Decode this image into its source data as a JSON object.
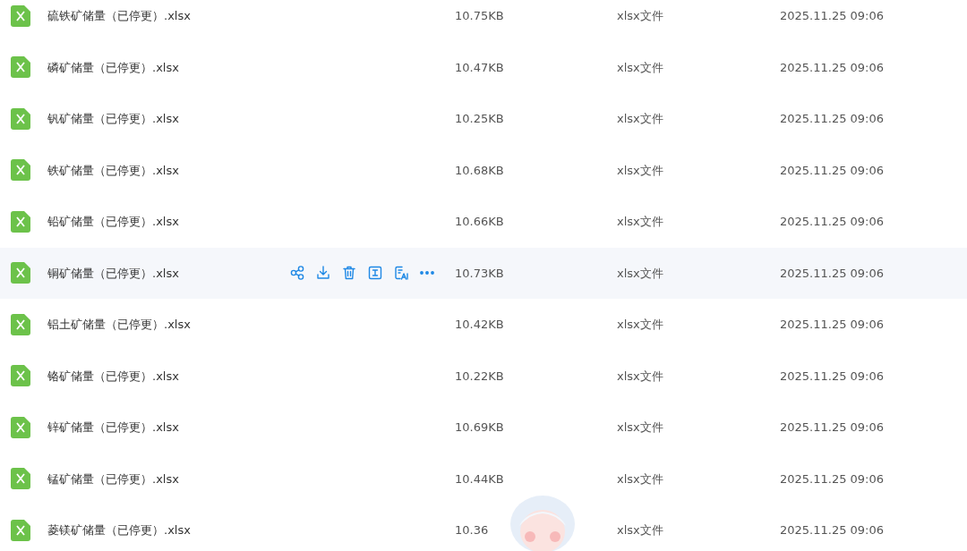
{
  "files": [
    {
      "name": "硫铁矿储量（已停更）.xlsx",
      "size": "10.75KB",
      "type": "xlsx文件",
      "modified": "2025.11.25 09:06",
      "hovered": false
    },
    {
      "name": "磷矿储量（已停更）.xlsx",
      "size": "10.47KB",
      "type": "xlsx文件",
      "modified": "2025.11.25 09:06",
      "hovered": false
    },
    {
      "name": "钒矿储量（已停更）.xlsx",
      "size": "10.25KB",
      "type": "xlsx文件",
      "modified": "2025.11.25 09:06",
      "hovered": false
    },
    {
      "name": "铁矿储量（已停更）.xlsx",
      "size": "10.68KB",
      "type": "xlsx文件",
      "modified": "2025.11.25 09:06",
      "hovered": false
    },
    {
      "name": "铅矿储量（已停更）.xlsx",
      "size": "10.66KB",
      "type": "xlsx文件",
      "modified": "2025.11.25 09:06",
      "hovered": false
    },
    {
      "name": "铜矿储量（已停更）.xlsx",
      "size": "10.73KB",
      "type": "xlsx文件",
      "modified": "2025.11.25 09:06",
      "hovered": true
    },
    {
      "name": "铝土矿储量（已停更）.xlsx",
      "size": "10.42KB",
      "type": "xlsx文件",
      "modified": "2025.11.25 09:06",
      "hovered": false
    },
    {
      "name": "铬矿储量（已停更）.xlsx",
      "size": "10.22KB",
      "type": "xlsx文件",
      "modified": "2025.11.25 09:06",
      "hovered": false
    },
    {
      "name": "锌矿储量（已停更）.xlsx",
      "size": "10.69KB",
      "type": "xlsx文件",
      "modified": "2025.11.25 09:06",
      "hovered": false
    },
    {
      "name": "锰矿储量（已停更）.xlsx",
      "size": "10.44KB",
      "type": "xlsx文件",
      "modified": "2025.11.25 09:06",
      "hovered": false
    },
    {
      "name": "菱镁矿储量（已停更）.xlsx",
      "size": "10.36",
      "type": "xlsx文件",
      "modified": "2025.11.25 09:06",
      "hovered": false
    }
  ]
}
